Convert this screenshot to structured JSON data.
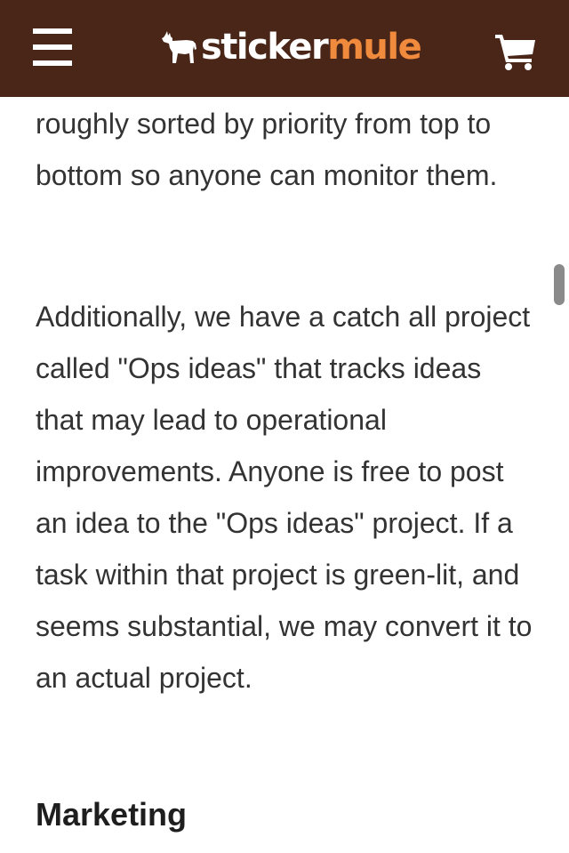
{
  "header": {
    "brand_part1": "sticker",
    "brand_part2": "mule",
    "background_color": "#4a2618",
    "accent_color": "#f08a3c",
    "menu_icon": "hamburger-menu-icon",
    "cart_icon": "shopping-cart-icon",
    "logo_icon": "mule-icon"
  },
  "article": {
    "paragraph_1": "roughly sorted by priority from top to bottom so anyone can monitor them.",
    "paragraph_2": "Additionally, we have a catch all project called \"Ops ideas\" that tracks ideas that may lead to operational improvements. Anyone is free to post an idea to the \"Ops ideas\" project. If a task within that project is green-lit, and seems substantial, we may convert it to an actual project.",
    "heading": "Marketing"
  }
}
